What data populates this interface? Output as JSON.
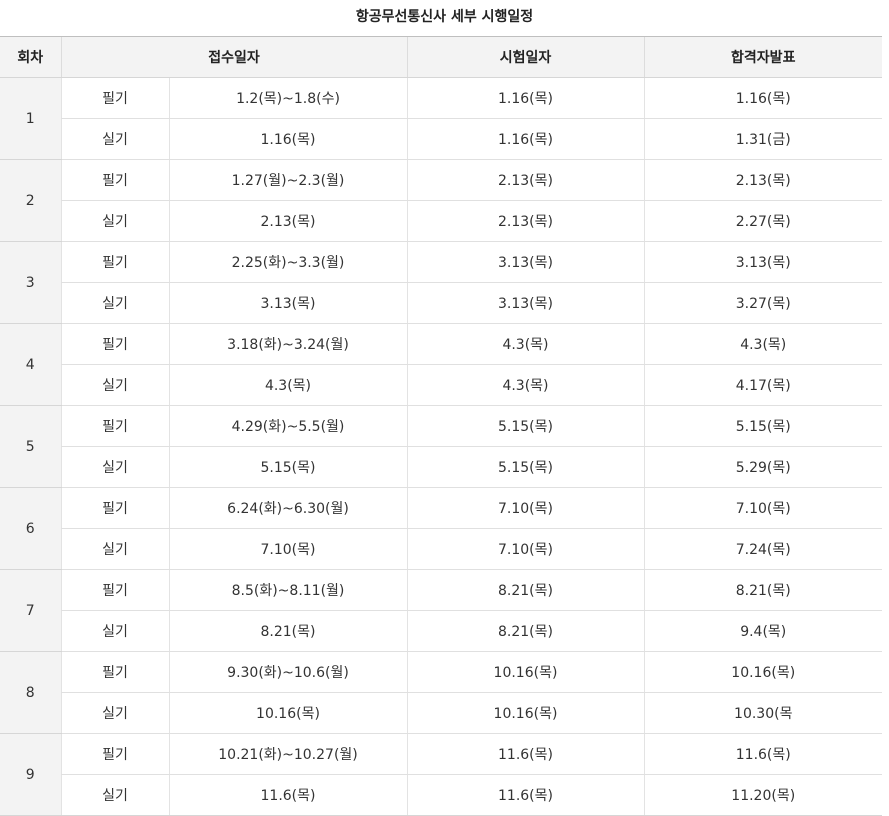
{
  "title": "항공무선통신사 세부 시행일정",
  "headers": {
    "round": "회차",
    "registration": "접수일자",
    "exam": "시험일자",
    "result": "합격자발표"
  },
  "rounds": [
    {
      "round": "1",
      "written": {
        "type": "필기",
        "registration": "1.2(목)~1.8(수)",
        "exam": "1.16(목)",
        "result": "1.16(목)"
      },
      "practical": {
        "type": "실기",
        "registration": "1.16(목)",
        "exam": "1.16(목)",
        "result": "1.31(금)"
      }
    },
    {
      "round": "2",
      "written": {
        "type": "필기",
        "registration": "1.27(월)~2.3(월)",
        "exam": "2.13(목)",
        "result": "2.13(목)"
      },
      "practical": {
        "type": "실기",
        "registration": "2.13(목)",
        "exam": "2.13(목)",
        "result": "2.27(목)"
      }
    },
    {
      "round": "3",
      "written": {
        "type": "필기",
        "registration": "2.25(화)~3.3(월)",
        "exam": "3.13(목)",
        "result": "3.13(목)"
      },
      "practical": {
        "type": "실기",
        "registration": "3.13(목)",
        "exam": "3.13(목)",
        "result": "3.27(목)"
      }
    },
    {
      "round": "4",
      "written": {
        "type": "필기",
        "registration": "3.18(화)~3.24(월)",
        "exam": "4.3(목)",
        "result": "4.3(목)"
      },
      "practical": {
        "type": "실기",
        "registration": "4.3(목)",
        "exam": "4.3(목)",
        "result": "4.17(목)"
      }
    },
    {
      "round": "5",
      "written": {
        "type": "필기",
        "registration": "4.29(화)~5.5(월)",
        "exam": "5.15(목)",
        "result": "5.15(목)"
      },
      "practical": {
        "type": "실기",
        "registration": "5.15(목)",
        "exam": "5.15(목)",
        "result": "5.29(목)"
      }
    },
    {
      "round": "6",
      "written": {
        "type": "필기",
        "registration": "6.24(화)~6.30(월)",
        "exam": "7.10(목)",
        "result": "7.10(목)"
      },
      "practical": {
        "type": "실기",
        "registration": "7.10(목)",
        "exam": "7.10(목)",
        "result": "7.24(목)"
      }
    },
    {
      "round": "7",
      "written": {
        "type": "필기",
        "registration": "8.5(화)~8.11(월)",
        "exam": "8.21(목)",
        "result": "8.21(목)"
      },
      "practical": {
        "type": "실기",
        "registration": "8.21(목)",
        "exam": "8.21(목)",
        "result": "9.4(목)"
      }
    },
    {
      "round": "8",
      "written": {
        "type": "필기",
        "registration": "9.30(화)~10.6(월)",
        "exam": "10.16(목)",
        "result": "10.16(목)"
      },
      "practical": {
        "type": "실기",
        "registration": "10.16(목)",
        "exam": "10.16(목)",
        "result": "10.30(목"
      }
    },
    {
      "round": "9",
      "written": {
        "type": "필기",
        "registration": "10.21(화)~10.27(월)",
        "exam": "11.6(목)",
        "result": "11.6(목)"
      },
      "practical": {
        "type": "실기",
        "registration": "11.6(목)",
        "exam": "11.6(목)",
        "result": "11.20(목)"
      }
    }
  ]
}
